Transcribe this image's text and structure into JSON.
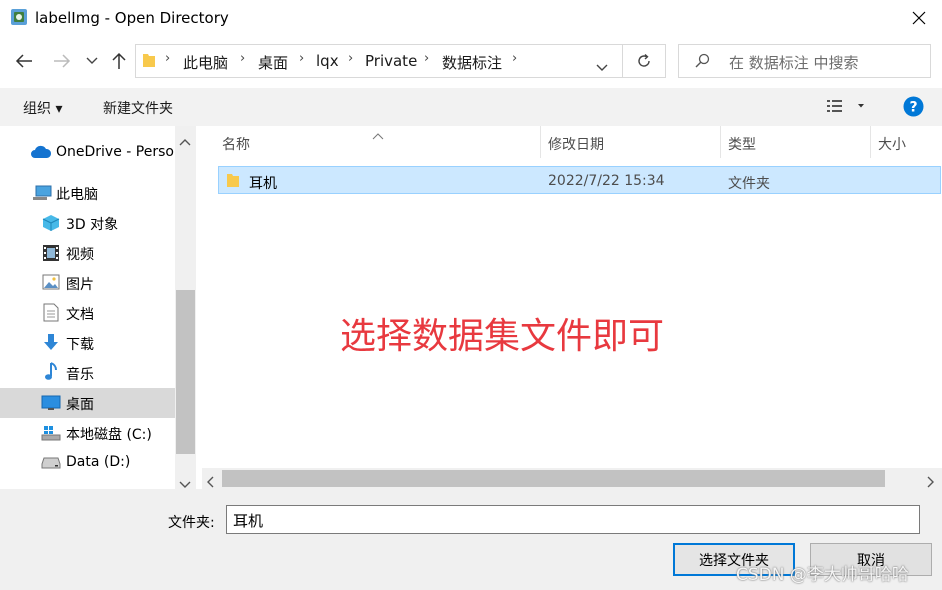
{
  "window": {
    "title": "labelImg - Open Directory"
  },
  "navigation": {
    "breadcrumbs": [
      "此电脑",
      "桌面",
      "lqx",
      "Private",
      "数据标注"
    ],
    "search_placeholder": "在 数据标注 中搜索"
  },
  "toolbar": {
    "organize_label": "组织 ▾",
    "new_folder_label": "新建文件夹"
  },
  "nav_pane": {
    "items": [
      {
        "label": "OneDrive - Perso",
        "icon": "cloud-icon"
      },
      {
        "label": "此电脑",
        "icon": "computer-icon"
      },
      {
        "label": "3D 对象",
        "icon": "cube-icon"
      },
      {
        "label": "视频",
        "icon": "film-icon"
      },
      {
        "label": "图片",
        "icon": "picture-icon"
      },
      {
        "label": "文档",
        "icon": "document-icon"
      },
      {
        "label": "下载",
        "icon": "download-icon"
      },
      {
        "label": "音乐",
        "icon": "music-icon"
      },
      {
        "label": "桌面",
        "icon": "desktop-icon",
        "selected": true
      },
      {
        "label": "本地磁盘 (C:)",
        "icon": "windows-drive-icon"
      },
      {
        "label": "Data (D:)",
        "icon": "drive-icon"
      }
    ]
  },
  "file_list": {
    "columns": [
      "名称",
      "修改日期",
      "类型",
      "大小"
    ],
    "rows": [
      {
        "name": "耳机",
        "modified": "2022/7/22 15:34",
        "type": "文件夹",
        "size": "",
        "selected": true
      }
    ]
  },
  "annotation": "选择数据集文件即可",
  "footer": {
    "folder_label": "文件夹:",
    "folder_value": "耳机",
    "select_button": "选择文件夹",
    "cancel_button": "取消"
  },
  "watermark": "CSDN @李大帅哥哈哈",
  "colors": {
    "accent": "#0078d7",
    "selection": "#cce8ff",
    "annotation": "#e8393f",
    "folder": "#f8c94c"
  }
}
